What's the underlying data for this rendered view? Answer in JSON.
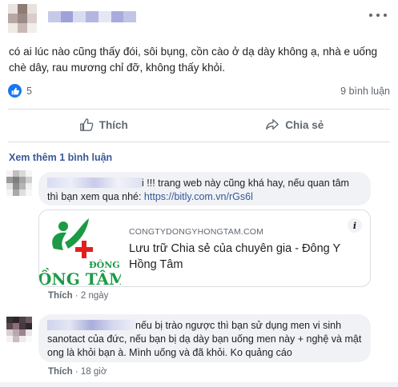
{
  "post": {
    "text": "có ai lúc nào cũng thấy đói, sôi bụng, cồn cào ở dạ dày không ạ, nhà e uống\nchè dây, rau mương chỉ đỡ, không thấy khỏi.",
    "like_count": "5",
    "comment_count": "9 bình luận",
    "like_label": "Thích",
    "share_label": "Chia sẻ"
  },
  "more_comments_label": "Xem thêm 1 bình luận",
  "comments": [
    {
      "text_before_link": "i !!! trang web này cũng khá hay, nếu quan tâm thì bạn xem qua nhé: ",
      "link": "https://bitly.com.vn/rGs6l",
      "like_label": "Thích",
      "time": "2 ngày",
      "preview": {
        "domain": "CONGTYDONGYHONGTAM.COM",
        "title": "Lưu trữ Chia sẻ của chuyên gia - Đông Y Hồng Tâm",
        "logo_text_1": "ĐÔNG",
        "logo_text_2": "ỒNG TÂM",
        "info_label": "i"
      }
    },
    {
      "text": "nếu bị trào ngược thì bạn sử dụng men vi sinh sanotact của đức, nếu bạn bị dạ dày bạn uống men này + nghệ và mật ong là khỏi bạn à. Mình uống và đã khỏi. Ko quảng cáo",
      "like_label": "Thích",
      "time": "18 giờ"
    }
  ],
  "colors": {
    "accent": "#1877f2",
    "link": "#385898",
    "bubble": "#f0f2f5",
    "logo_green": "#1c9a45"
  },
  "icons": [
    "more-horizontal-icon",
    "like-reaction-icon",
    "thumbs-up-icon",
    "share-arrow-icon",
    "info-icon"
  ]
}
